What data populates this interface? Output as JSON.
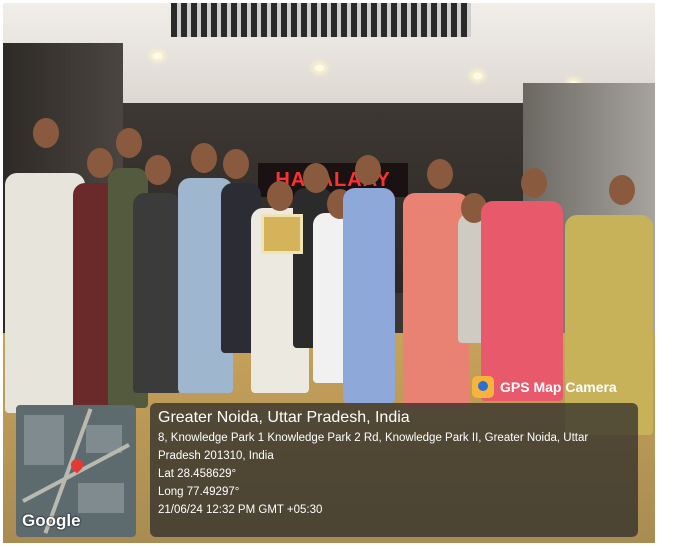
{
  "scene": {
    "wall_sign": "HAI ALAAY"
  },
  "gps_camera": {
    "app_label": "GPS Map Camera",
    "place": "Greater Noida, Uttar Pradesh, India",
    "address_line1": "8, Knowledge Park 1 Knowledge Park 2 Rd, Knowledge Park II, Greater Noida, Uttar",
    "address_line2": "Pradesh 201310, India",
    "lat": "Lat 28.458629°",
    "long": "Long 77.49297°",
    "timestamp": "21/06/24 12:32 PM GMT +05:30",
    "map_brand": "Google"
  }
}
